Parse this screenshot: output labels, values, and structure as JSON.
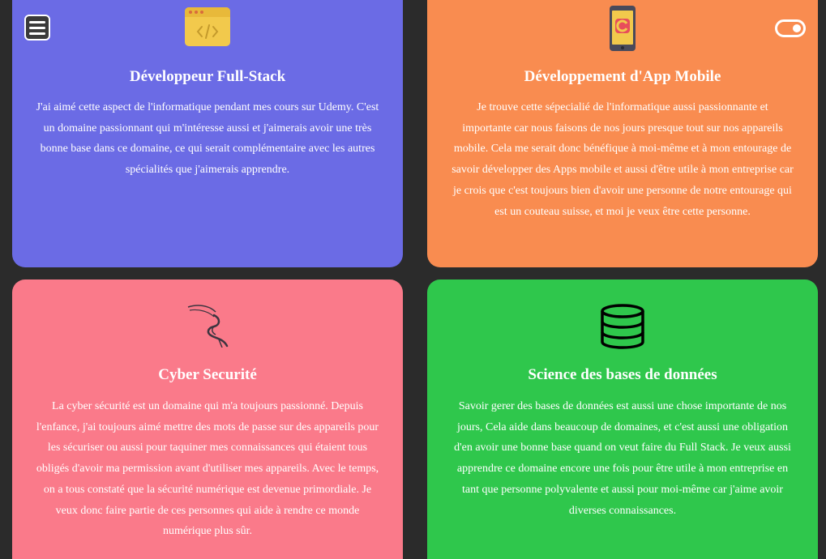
{
  "header": {
    "menu_icon": "hamburger-menu-icon",
    "toggle_icon": "theme-toggle-icon"
  },
  "cards": [
    {
      "icon": "code-window-icon",
      "title": "Développeur Full-Stack",
      "text": "J'ai aimé cette aspect de l'informatique pendant mes cours sur Udemy. C'est un domaine passionnant qui m'intéresse aussi et j'aimerais avoir une très bonne base dans ce domaine, ce qui serait complémentaire avec les autres spécialités que j'aimerais apprendre.",
      "color": "#6b6be5"
    },
    {
      "icon": "smartphone-app-icon",
      "title": "Développement d'App Mobile",
      "text": "Je trouve cette sépecialié de l'informatique aussi passionnante et importante car nous faisons de nos jours presque tout sur nos appareils mobile. Cela me serait donc bénéfique à moi-même et à mon entourage de savoir développer des Apps mobile et aussi d'être utile à mon entreprise car je crois que c'est toujours bien d'avoir une personne de notre entourage qui est un couteau suisse, et moi je veux être cette personne.",
      "color": "#f98c50"
    },
    {
      "icon": "kali-dragon-icon",
      "title": "Cyber Securité",
      "text": "La cyber sécurité est un domaine qui m'a toujours passionné. Depuis l'enfance, j'ai toujours aimé mettre des mots de passe sur des appareils pour les sécuriser ou aussi pour taquiner mes connaissances qui étaient tous obligés d'avoir ma permission avant d'utiliser mes appareils. Avec le temps, on a tous constaté que la sécurité numérique est devenue primordiale. Je veux donc faire partie de ces personnes qui aide à rendre ce monde numérique plus sûr.",
      "color": "#fa7a8a"
    },
    {
      "icon": "database-icon",
      "title": "Science des bases de données",
      "text": "Savoir gerer des bases de données est aussi une chose importante de nos jours, Cela aide dans beaucoup de domaines, et c'est aussi une obligation d'en avoir une bonne base quand on veut faire du Full Stack. Je veux aussi apprendre ce domaine encore une fois pour être utile à mon entreprise en tant que personne polyvalente et aussi pour moi-même car j'aime avoir diverses connaissances.",
      "color": "#2fc74c"
    }
  ]
}
